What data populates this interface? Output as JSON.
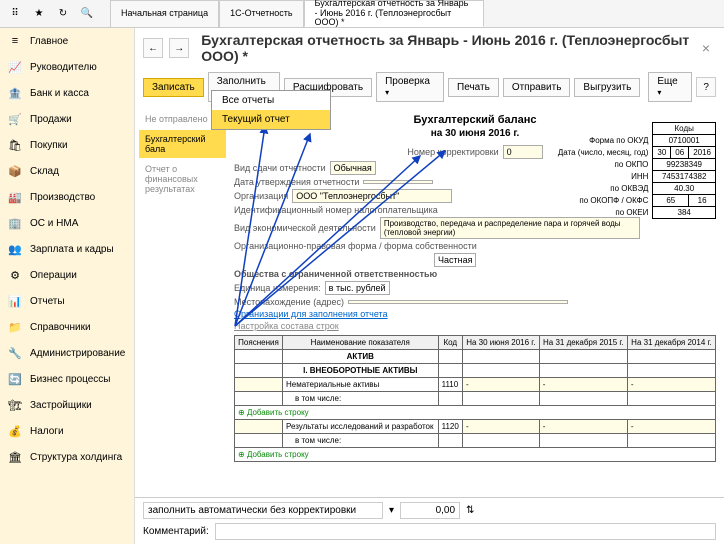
{
  "toolbar": {
    "tabs": [
      {
        "label": "Начальная страница"
      },
      {
        "label": "1С-Отчетность"
      },
      {
        "label": "Бухгалтерская отчетность за Январь - Июнь 2016 г. (Теплоэнергосбыт ООО) *"
      }
    ]
  },
  "sidebar": {
    "items": [
      {
        "icon": "≡",
        "label": "Главное"
      },
      {
        "icon": "📈",
        "label": "Руководителю"
      },
      {
        "icon": "🏦",
        "label": "Банк и касса"
      },
      {
        "icon": "🛒",
        "label": "Продажи"
      },
      {
        "icon": "🛍",
        "label": "Покупки"
      },
      {
        "icon": "📦",
        "label": "Склад"
      },
      {
        "icon": "🏭",
        "label": "Производство"
      },
      {
        "icon": "🏢",
        "label": "ОС и НМА"
      },
      {
        "icon": "👥",
        "label": "Зарплата и кадры"
      },
      {
        "icon": "⚙",
        "label": "Операции"
      },
      {
        "icon": "📊",
        "label": "Отчеты"
      },
      {
        "icon": "📁",
        "label": "Справочники"
      },
      {
        "icon": "🔧",
        "label": "Администрирование"
      },
      {
        "icon": "🔄",
        "label": "Бизнес процессы"
      },
      {
        "icon": "🏗",
        "label": "Застройщики"
      },
      {
        "icon": "💰",
        "label": "Налоги"
      },
      {
        "icon": "🏛",
        "label": "Структура холдинга"
      }
    ]
  },
  "page": {
    "title": "Бухгалтерская отчетность за Январь - Июнь 2016 г. (Теплоэнергосбыт ООО) *"
  },
  "buttons": {
    "save": "Записать",
    "fill": "Заполнить",
    "decrypt": "Расшифровать",
    "check": "Проверка",
    "print": "Печать",
    "send": "Отправить",
    "export": "Выгрузить",
    "more": "Еще"
  },
  "dropdown": {
    "item1": "Все отчеты",
    "item2": "Текущий отчет"
  },
  "subnav": {
    "not_sent": "Не отправлено",
    "active": "Бухгалтерский бала",
    "fin": "Отчет о финансовых результатах"
  },
  "report": {
    "title": "Бухгалтерский баланс",
    "date_line": "на 30 июня 2016 г.",
    "corr_label": "Номер корректировки",
    "corr_value": "0",
    "vid_sdachi_label": "Вид сдачи отчетности",
    "vid_sdachi_value": "Обычная",
    "date_appr_label": "Дата утверждения отчетности",
    "org_label": "Организация",
    "org_value": "ООО \"Теплоэнергосбыт\"",
    "inn_label": "Идентификационный номер налогоплательщика",
    "activity_label": "Вид экономической деятельности",
    "activity_value": "Производство, передача и распределение пара и горячей воды (тепловой энергии)",
    "form_label": "Организационно-правовая форма / форма собственности",
    "form_value": "Частная",
    "ooo_label": "Общества с ограниченной ответственностью",
    "unit_label": "Единица измерения:",
    "unit_value": "в тыс. рублей",
    "addr_label": "Местонахождение (адрес)",
    "link_orgs": "Организации для заполнения отчета",
    "link_rows": "Настройка состава строк"
  },
  "codes": {
    "kody_hdr": "Коды",
    "okud_label": "Форма по ОКУД",
    "okud": "0710001",
    "date_label": "Дата (число, месяц, год)",
    "date_d": "30",
    "date_m": "06",
    "date_y": "2016",
    "okpo_label": "по ОКПО",
    "okpo": "99238349",
    "inn_label": "ИНН",
    "inn": "7453174382",
    "okved_label": "по ОКВЭД",
    "okved": "40.30",
    "okopf_label": "по ОКОПФ / ОКФС",
    "okopf_1": "65",
    "okopf_2": "16",
    "okei_label": "по ОКЕИ",
    "okei": "384"
  },
  "table": {
    "h_expl": "Пояснения",
    "h_name": "Наименование показателя",
    "h_code": "Код",
    "h_c1": "На 30 июня 2016 г.",
    "h_c2": "На 31 декабря 2015 г.",
    "h_c3": "На 31 декабря 2014 г.",
    "aktiv": "АКТИВ",
    "section1": "I. ВНЕОБОРОТНЫЕ АКТИВЫ",
    "row1_name": "Нематериальные активы",
    "row1_code": "1110",
    "row1_sub": "в том числе:",
    "add": "Добавить строку",
    "row2_name": "Результаты исследований и разработок",
    "row2_code": "1120",
    "row2_sub": "в том числе:",
    "dash": "-"
  },
  "bottom": {
    "mode": "заполнить автоматически без корректировки",
    "val": "0,00",
    "comment_label": "Комментарий:"
  }
}
